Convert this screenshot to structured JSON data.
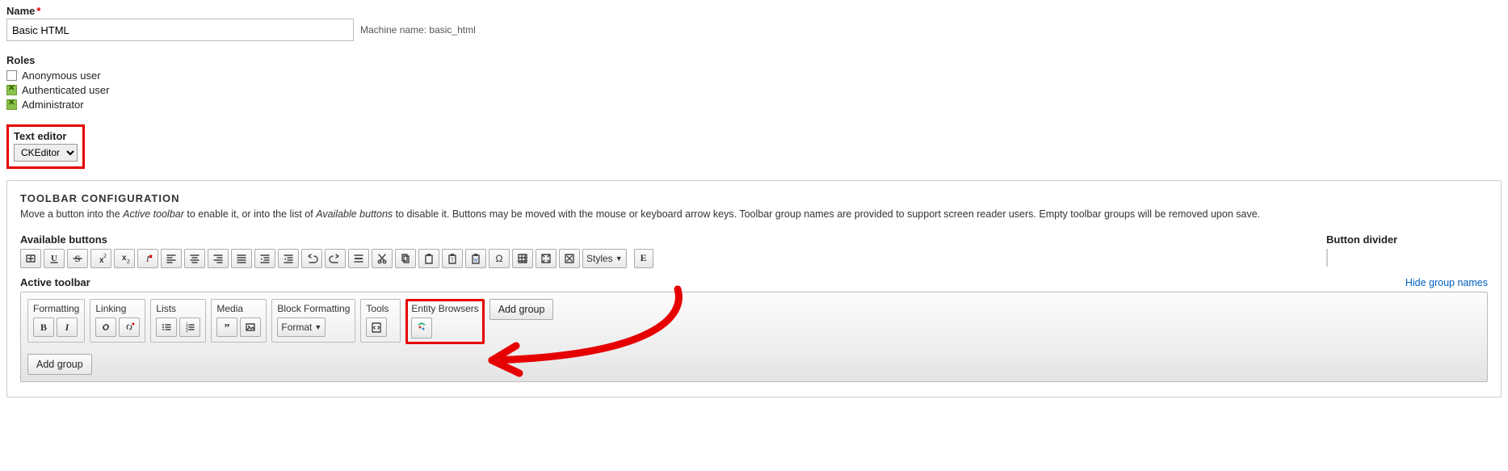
{
  "name_field": {
    "label": "Name",
    "value": "Basic HTML"
  },
  "machine_name": {
    "prefix": "Machine name:",
    "value": "basic_html"
  },
  "roles": {
    "label": "Roles",
    "items": [
      {
        "label": "Anonymous user",
        "checked": false
      },
      {
        "label": "Authenticated user",
        "checked": true
      },
      {
        "label": "Administrator",
        "checked": true
      }
    ]
  },
  "text_editor": {
    "label": "Text editor",
    "value": "CKEditor"
  },
  "toolbar_config": {
    "title": "TOOLBAR CONFIGURATION",
    "desc_pre": "Move a button into the ",
    "desc_em1": "Active toolbar",
    "desc_mid1": " to enable it, or into the list of ",
    "desc_em2": "Available buttons",
    "desc_mid2": " to disable it. Buttons may be moved with the mouse or keyboard arrow keys. Toolbar group names are provided to support screen reader users. Empty toolbar groups will be removed upon save.",
    "available_label": "Available buttons",
    "divider_label": "Button divider",
    "active_label": "Active toolbar",
    "hide_link": "Hide group names",
    "add_group": "Add group",
    "available_buttons": [
      "language",
      "underline",
      "strike",
      "superscript",
      "subscript",
      "remove-format",
      "align-left",
      "align-center",
      "align-right",
      "align-justify",
      "indent",
      "outdent",
      "undo",
      "redo",
      "hr",
      "cut",
      "copy",
      "paste",
      "paste-text",
      "paste-word",
      "special-char",
      "table",
      "maximize",
      "show-blocks"
    ],
    "styles_label": "Styles",
    "e_label": "E"
  },
  "active_groups": [
    {
      "name": "Formatting",
      "buttons": [
        "bold",
        "italic"
      ]
    },
    {
      "name": "Linking",
      "buttons": [
        "link",
        "unlink"
      ]
    },
    {
      "name": "Lists",
      "buttons": [
        "bulleted",
        "numbered"
      ]
    },
    {
      "name": "Media",
      "buttons": [
        "blockquote",
        "image"
      ]
    },
    {
      "name": "Block Formatting",
      "buttons": [
        "format-dropdown"
      ],
      "format_label": "Format"
    },
    {
      "name": "Tools",
      "buttons": [
        "source"
      ]
    },
    {
      "name": "Entity Browsers",
      "buttons": [
        "entity-browser"
      ],
      "highlight": true
    }
  ]
}
